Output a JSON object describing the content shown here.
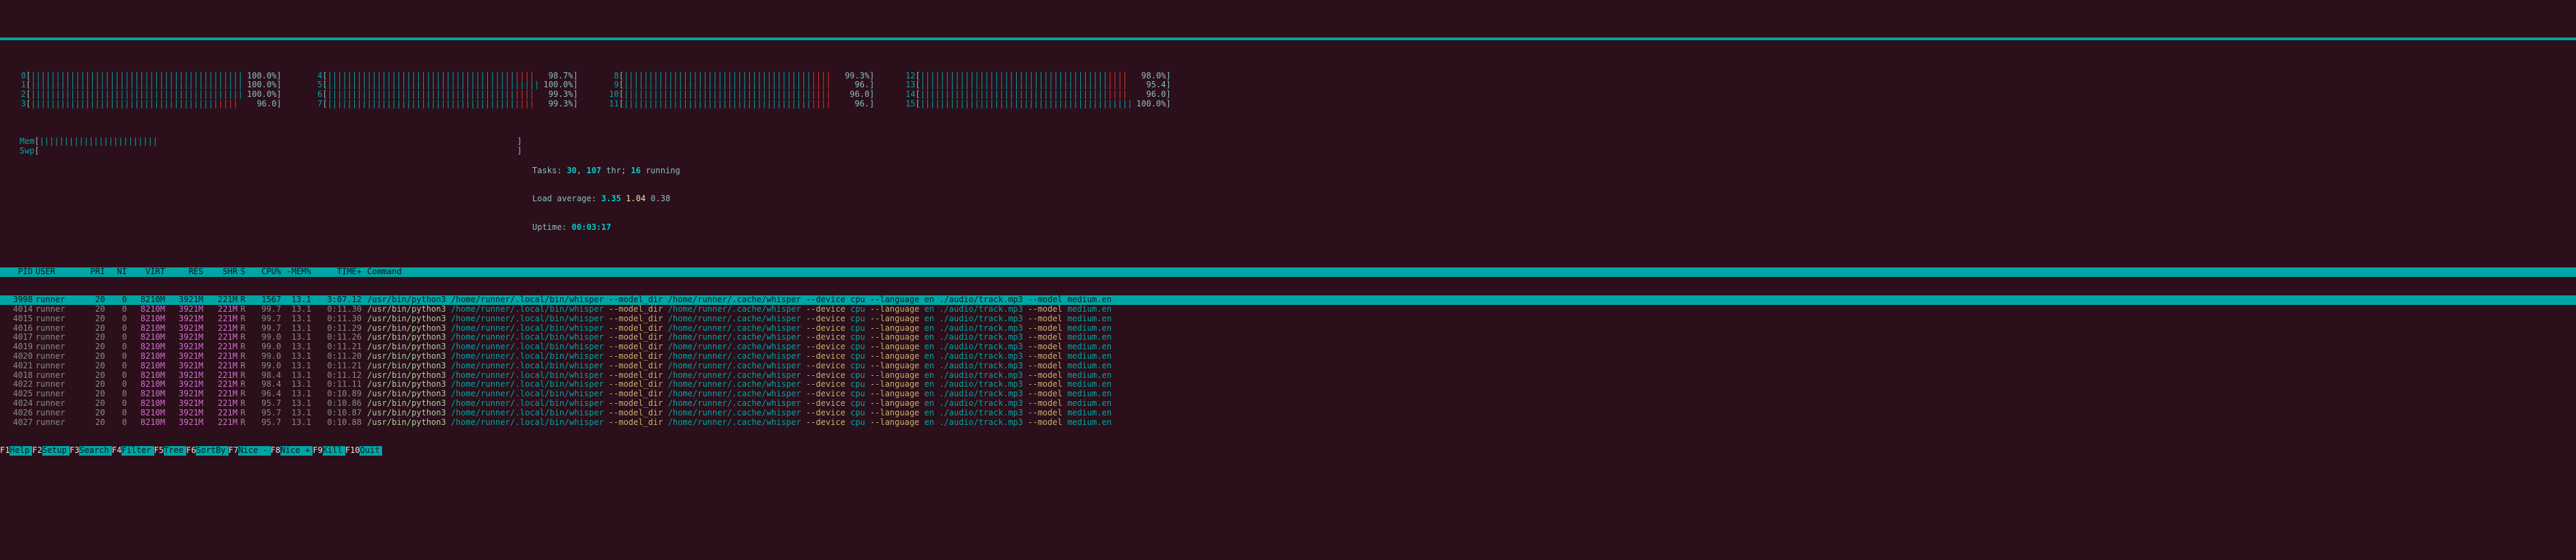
{
  "cpus": [
    {
      "id": "0",
      "pct": "100.0%",
      "hot": false
    },
    {
      "id": "1",
      "pct": "100.0%",
      "hot": false
    },
    {
      "id": "2",
      "pct": "100.0%",
      "hot": false
    },
    {
      "id": "3",
      "pct": "96.0",
      "hot": true
    },
    {
      "id": "4",
      "pct": "98.7%",
      "hot": true
    },
    {
      "id": "5",
      "pct": "100.0%",
      "hot": false
    },
    {
      "id": "6",
      "pct": "99.3%",
      "hot": true
    },
    {
      "id": "7",
      "pct": "99.3%",
      "hot": true
    },
    {
      "id": "8",
      "pct": "99.3%",
      "hot": true
    },
    {
      "id": "9",
      "pct": "96.",
      "hot": true
    },
    {
      "id": "10",
      "pct": "96.0",
      "hot": true
    },
    {
      "id": "11",
      "pct": "96.",
      "hot": true
    },
    {
      "id": "12",
      "pct": "98.0%",
      "hot": true
    },
    {
      "id": "13",
      "pct": "95.4",
      "hot": true
    },
    {
      "id": "14",
      "pct": "96.0",
      "hot": true
    },
    {
      "id": "15",
      "pct": "100.0%",
      "hot": false
    }
  ],
  "mem_label": "Mem",
  "mem_pct": "",
  "swp_label": "Swp",
  "tasks_line_prefix": "Tasks: ",
  "tasks_counts": "30",
  "tasks_thr_label": ", ",
  "tasks_thr": "107",
  "tasks_thr_suffix": " thr; ",
  "tasks_running": "16",
  "tasks_running_suffix": " running",
  "la_label": "Load average: ",
  "la1": "3.35",
  "la2": "1.04",
  "la3": "0.38",
  "uptime_label": "Uptime: ",
  "uptime": "00:03:17",
  "headers": {
    "pid": "PID",
    "user": "USER",
    "pri": "PRI",
    "ni": "NI",
    "virt": "VIRT",
    "res": "RES",
    "shr": "SHR",
    "s": "S",
    "cpu": "CPU%",
    "mem": "-MEM%",
    "time": "TIME+",
    "cmd": "Command"
  },
  "cmd_parts": {
    "exe": "/usr/bin/python3",
    "wh": "/home/runner/.local/bin/whisper",
    "opt1": "--model_dir",
    "md": "/home/runner/.cache/whisper",
    "opt2": "--device",
    "dev": "cpu",
    "opt3": "--language",
    "lang": "en",
    "file": "./audio/track.mp3",
    "opt4": "--model",
    "model": "medium.en"
  },
  "procs": [
    {
      "pid": "3998",
      "user": "runner",
      "pri": "20",
      "ni": "0",
      "virt": "8210M",
      "res": "3921M",
      "shr": "221M",
      "s": "R",
      "cpu": "1567",
      "mem": "13.1",
      "time": "3:07.12",
      "hl": true
    },
    {
      "pid": "4014",
      "user": "runner",
      "pri": "20",
      "ni": "0",
      "virt": "8210M",
      "res": "3921M",
      "shr": "221M",
      "s": "R",
      "cpu": "99.7",
      "mem": "13.1",
      "time": "0:11.30"
    },
    {
      "pid": "4015",
      "user": "runner",
      "pri": "20",
      "ni": "0",
      "virt": "8210M",
      "res": "3921M",
      "shr": "221M",
      "s": "R",
      "cpu": "99.7",
      "mem": "13.1",
      "time": "0:11.30"
    },
    {
      "pid": "4016",
      "user": "runner",
      "pri": "20",
      "ni": "0",
      "virt": "8210M",
      "res": "3921M",
      "shr": "221M",
      "s": "R",
      "cpu": "99.7",
      "mem": "13.1",
      "time": "0:11.29"
    },
    {
      "pid": "4017",
      "user": "runner",
      "pri": "20",
      "ni": "0",
      "virt": "8210M",
      "res": "3921M",
      "shr": "221M",
      "s": "R",
      "cpu": "99.0",
      "mem": "13.1",
      "time": "0:11.26"
    },
    {
      "pid": "4019",
      "user": "runner",
      "pri": "20",
      "ni": "0",
      "virt": "8210M",
      "res": "3921M",
      "shr": "221M",
      "s": "R",
      "cpu": "99.0",
      "mem": "13.1",
      "time": "0:11.21"
    },
    {
      "pid": "4020",
      "user": "runner",
      "pri": "20",
      "ni": "0",
      "virt": "8210M",
      "res": "3921M",
      "shr": "221M",
      "s": "R",
      "cpu": "99.0",
      "mem": "13.1",
      "time": "0:11.20"
    },
    {
      "pid": "4021",
      "user": "runner",
      "pri": "20",
      "ni": "0",
      "virt": "8210M",
      "res": "3921M",
      "shr": "221M",
      "s": "R",
      "cpu": "99.0",
      "mem": "13.1",
      "time": "0:11.21"
    },
    {
      "pid": "4018",
      "user": "runner",
      "pri": "20",
      "ni": "0",
      "virt": "8210M",
      "res": "3921M",
      "shr": "221M",
      "s": "R",
      "cpu": "98.4",
      "mem": "13.1",
      "time": "0:11.12"
    },
    {
      "pid": "4022",
      "user": "runner",
      "pri": "20",
      "ni": "0",
      "virt": "8210M",
      "res": "3921M",
      "shr": "221M",
      "s": "R",
      "cpu": "98.4",
      "mem": "13.1",
      "time": "0:11.11"
    },
    {
      "pid": "4025",
      "user": "runner",
      "pri": "20",
      "ni": "0",
      "virt": "8210M",
      "res": "3921M",
      "shr": "221M",
      "s": "R",
      "cpu": "96.4",
      "mem": "13.1",
      "time": "0:10.89"
    },
    {
      "pid": "4024",
      "user": "runner",
      "pri": "20",
      "ni": "0",
      "virt": "8210M",
      "res": "3921M",
      "shr": "221M",
      "s": "R",
      "cpu": "95.7",
      "mem": "13.1",
      "time": "0:10.86"
    },
    {
      "pid": "4026",
      "user": "runner",
      "pri": "20",
      "ni": "0",
      "virt": "8210M",
      "res": "3921M",
      "shr": "221M",
      "s": "R",
      "cpu": "95.7",
      "mem": "13.1",
      "time": "0:10.87"
    },
    {
      "pid": "4027",
      "user": "runner",
      "pri": "20",
      "ni": "0",
      "virt": "8210M",
      "res": "3921M",
      "shr": "221M",
      "s": "R",
      "cpu": "95.7",
      "mem": "13.1",
      "time": "0:10.88"
    }
  ],
  "fkeys": [
    {
      "k": "F1",
      "l": "Help"
    },
    {
      "k": "F2",
      "l": "Setup"
    },
    {
      "k": "F3",
      "l": "Search"
    },
    {
      "k": "F4",
      "l": "Filter"
    },
    {
      "k": "F5",
      "l": "Tree"
    },
    {
      "k": "F6",
      "l": "SortBy"
    },
    {
      "k": "F7",
      "l": "Nice -"
    },
    {
      "k": "F8",
      "l": "Nice +"
    },
    {
      "k": "F9",
      "l": "Kill"
    },
    {
      "k": "F10",
      "l": "Quit"
    }
  ]
}
